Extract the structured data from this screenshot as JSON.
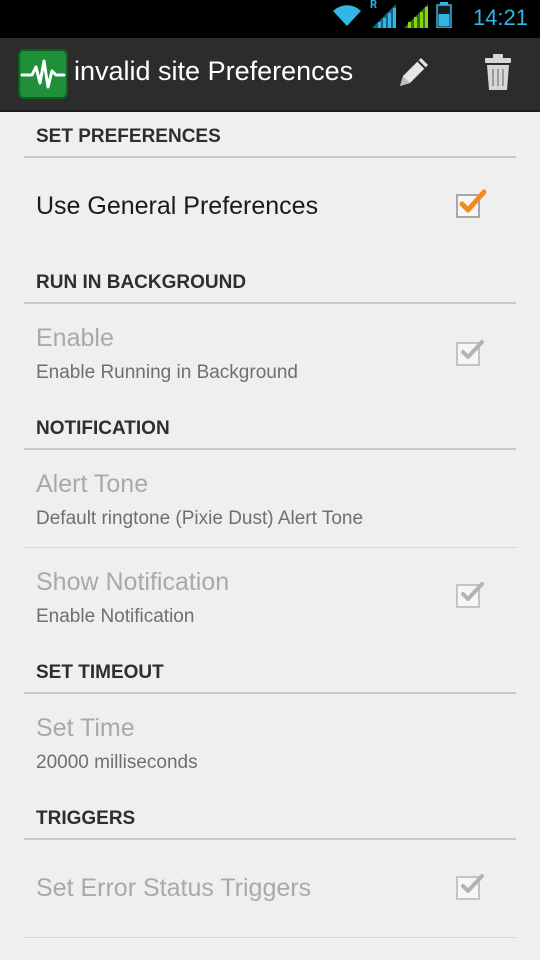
{
  "status_bar": {
    "time": "14:21",
    "icons": [
      "wifi-icon",
      "signal-roaming-icon",
      "signal-icon",
      "battery-icon"
    ],
    "roaming_indicator": "R"
  },
  "action_bar": {
    "title": "invalid site Preferences",
    "app_icon": "pulse-waveform-icon",
    "actions": [
      {
        "icon": "pencil-icon"
      },
      {
        "icon": "trash-icon"
      }
    ]
  },
  "sections": [
    {
      "header": "SET PREFERENCES",
      "items": [
        {
          "title": "Use General Preferences",
          "summary": "",
          "checked": true,
          "enabled": true,
          "has_checkbox": true
        }
      ]
    },
    {
      "header": "RUN IN BACKGROUND",
      "items": [
        {
          "title": "Enable",
          "summary": "Enable Running in Background",
          "checked": true,
          "enabled": false,
          "has_checkbox": true
        }
      ]
    },
    {
      "header": "NOTIFICATION",
      "items": [
        {
          "title": "Alert Tone",
          "summary": "Default ringtone (Pixie Dust) Alert Tone",
          "enabled": false,
          "has_checkbox": false
        },
        {
          "title": "Show Notification",
          "summary": "Enable Notification",
          "checked": true,
          "enabled": false,
          "has_checkbox": true
        }
      ]
    },
    {
      "header": "SET TIMEOUT",
      "items": [
        {
          "title": "Set Time",
          "summary": "20000 milliseconds",
          "enabled": false,
          "has_checkbox": false
        }
      ]
    },
    {
      "header": "TRIGGERS",
      "items": [
        {
          "title": "Set Error Status Triggers",
          "summary": "",
          "checked": true,
          "enabled": false,
          "has_checkbox": true
        }
      ]
    }
  ],
  "colors": {
    "accent_blue": "#33b5e5",
    "check_enabled": "#f28a1c",
    "check_disabled": "#b3b3b3",
    "app_icon_green": "#1f8f3a"
  }
}
